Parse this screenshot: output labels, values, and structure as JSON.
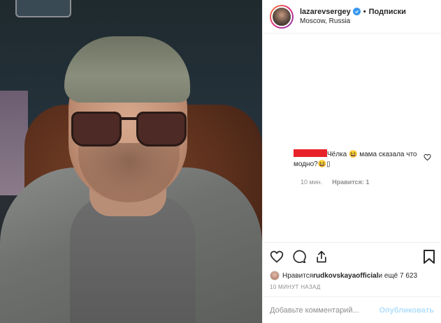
{
  "header": {
    "username": "lazarevsergey",
    "separator": "•",
    "follow_label": "Подписки",
    "location": "Moscow, Russia"
  },
  "comment": {
    "text": "Чёлка 😆 мама сказала что модно?😆▯",
    "time": "10 мин.",
    "likes": "Нравится: 1"
  },
  "likes": {
    "prefix": "Нравится ",
    "user": "rudkovskayaofficial",
    "suffix": " и ещё 7 623"
  },
  "timestamp": "10 МИНУТ НАЗАД",
  "add_comment": {
    "placeholder": "Добавьте комментарий...",
    "publish_label": "Опубликовать"
  },
  "icons": {
    "like": "heart-icon",
    "comment": "comment-icon",
    "share": "share-icon",
    "save": "bookmark-icon"
  },
  "colors": {
    "verified": "#3897f0",
    "redaction": "#e8222a",
    "publish_disabled": "#b2dffc"
  }
}
